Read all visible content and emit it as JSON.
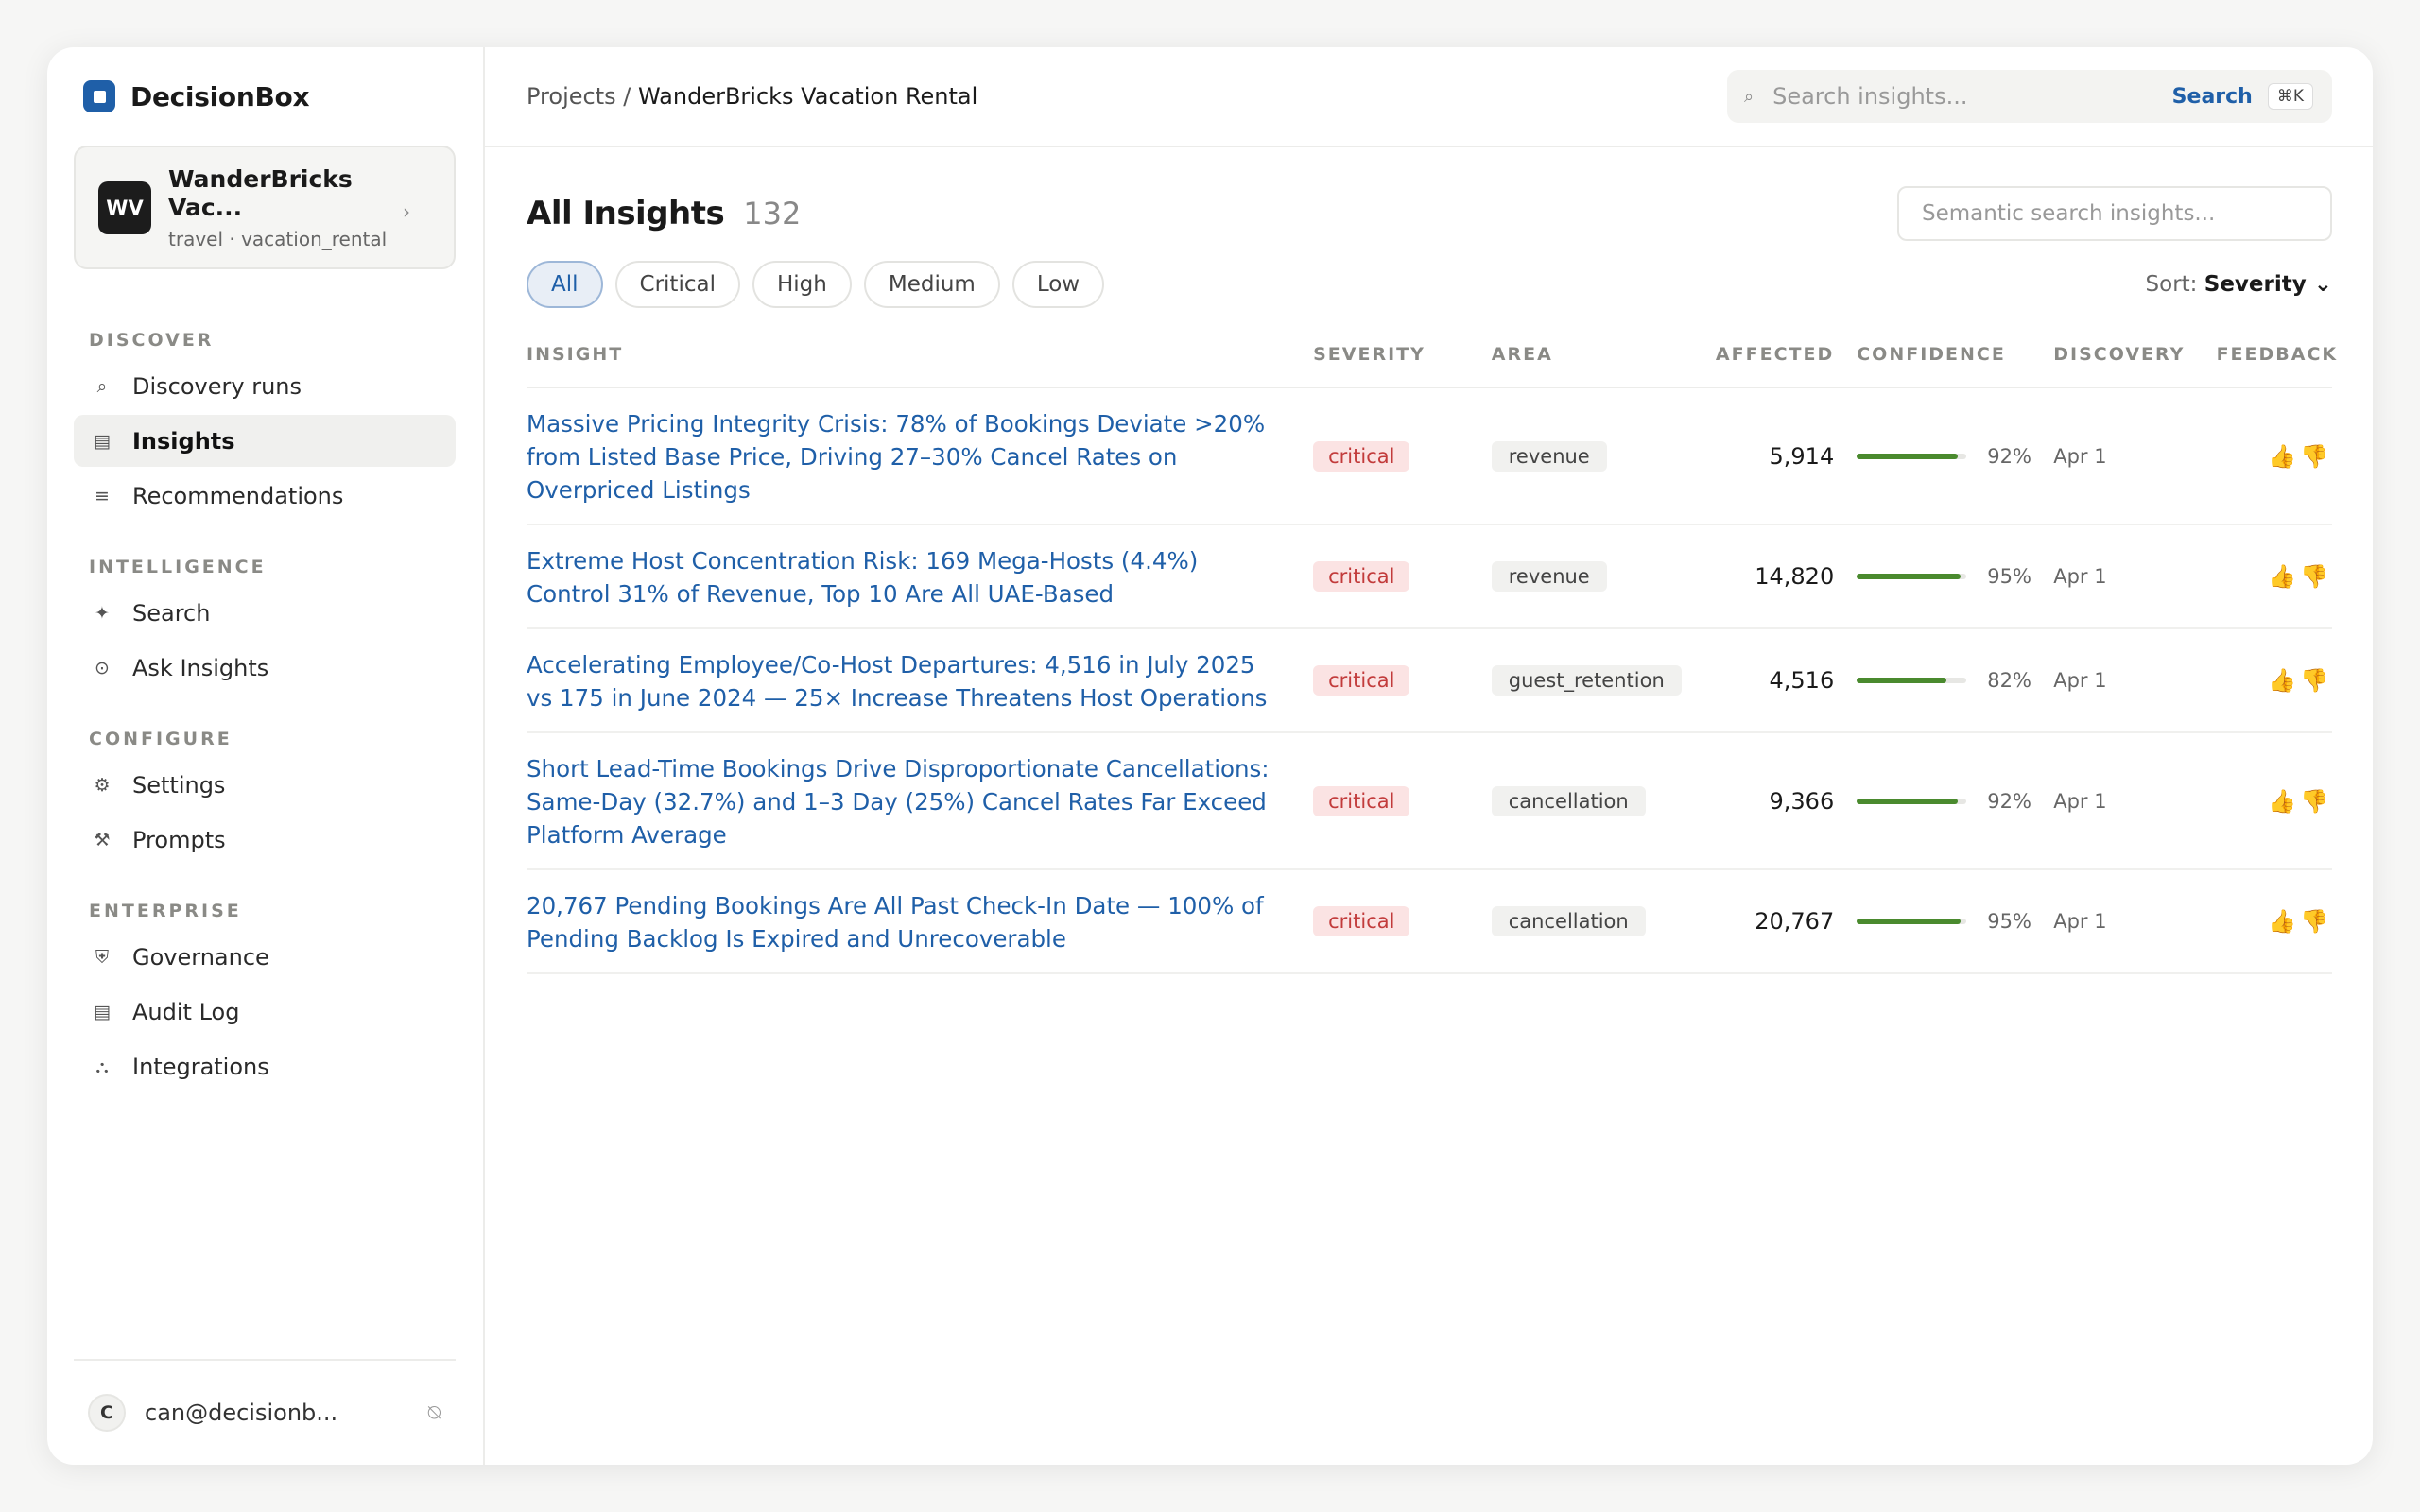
{
  "app": {
    "name": "DecisionBox"
  },
  "project": {
    "initials": "WV",
    "name": "WanderBricks Vac...",
    "meta": "travel · vacation_rental"
  },
  "sidebar": {
    "sections": [
      {
        "title": "DISCOVER",
        "items": [
          {
            "label": "Discovery runs",
            "icon": "search-icon",
            "glyph": "⌕"
          },
          {
            "label": "Insights",
            "icon": "list-icon",
            "glyph": "▤"
          },
          {
            "label": "Recommendations",
            "icon": "menu-icon",
            "glyph": "≡"
          }
        ]
      },
      {
        "title": "INTELLIGENCE",
        "items": [
          {
            "label": "Search",
            "icon": "sparkle-icon",
            "glyph": "✦"
          },
          {
            "label": "Ask Insights",
            "icon": "chat-icon",
            "glyph": "⊙"
          }
        ]
      },
      {
        "title": "CONFIGURE",
        "items": [
          {
            "label": "Settings",
            "icon": "gear-icon",
            "glyph": "⚙"
          },
          {
            "label": "Prompts",
            "icon": "tools-icon",
            "glyph": "⚒"
          }
        ]
      },
      {
        "title": "ENTERPRISE",
        "items": [
          {
            "label": "Governance",
            "icon": "shield-icon",
            "glyph": "⛨"
          },
          {
            "label": "Audit Log",
            "icon": "log-icon",
            "glyph": "▤"
          },
          {
            "label": "Integrations",
            "icon": "integrations-icon",
            "glyph": "⛬"
          }
        ]
      }
    ],
    "active": "Insights"
  },
  "user": {
    "initial": "C",
    "email": "can@decisionb..."
  },
  "topbar": {
    "breadcrumb_root": "Projects",
    "breadcrumb_sep": " / ",
    "breadcrumb_current": "WanderBricks Vacation Rental",
    "search_placeholder": "Search insights...",
    "search_button": "Search",
    "shortcut": "⌘K"
  },
  "page": {
    "title": "All Insights",
    "count": "132",
    "semantic_placeholder": "Semantic search insights...",
    "filters": [
      "All",
      "Critical",
      "High",
      "Medium",
      "Low"
    ],
    "active_filter": "All",
    "sort_label": "Sort:",
    "sort_value": "Severity ⌄"
  },
  "table": {
    "headers": [
      "INSIGHT",
      "SEVERITY",
      "AREA",
      "AFFECTED",
      "CONFIDENCE",
      "DISCOVERY",
      "FEEDBACK"
    ],
    "rows": [
      {
        "insight": "Massive Pricing Integrity Crisis: 78% of Bookings Deviate >20% from Listed Base Price, Driving 27–30% Cancel Rates on Overpriced Listings",
        "severity": "critical",
        "area": "revenue",
        "affected": "5,914",
        "confidence": 92,
        "confidence_label": "92%",
        "discovery": "Apr 1"
      },
      {
        "insight": "Extreme Host Concentration Risk: 169 Mega-Hosts (4.4%) Control 31% of Revenue, Top 10 Are All UAE-Based",
        "severity": "critical",
        "area": "revenue",
        "affected": "14,820",
        "confidence": 95,
        "confidence_label": "95%",
        "discovery": "Apr 1"
      },
      {
        "insight": "Accelerating Employee/Co-Host Departures: 4,516 in July 2025 vs 175 in June 2024 — 25× Increase Threatens Host Operations",
        "severity": "critical",
        "area": "guest_retention",
        "affected": "4,516",
        "confidence": 82,
        "confidence_label": "82%",
        "discovery": "Apr 1"
      },
      {
        "insight": "Short Lead-Time Bookings Drive Disproportionate Cancellations: Same-Day (32.7%) and 1–3 Day (25%) Cancel Rates Far Exceed Platform Average",
        "severity": "critical",
        "area": "cancellation",
        "affected": "9,366",
        "confidence": 92,
        "confidence_label": "92%",
        "discovery": "Apr 1"
      },
      {
        "insight": "20,767 Pending Bookings Are All Past Check-In Date — 100% of Pending Backlog Is Expired and Unrecoverable",
        "severity": "critical",
        "area": "cancellation",
        "affected": "20,767",
        "confidence": 95,
        "confidence_label": "95%",
        "discovery": "Apr 1"
      }
    ],
    "feedback_up": "👍",
    "feedback_down": "👎"
  },
  "colors": {
    "accent": "#1f5fa8",
    "critical_bg": "#fbe3e3",
    "critical_text": "#c23b3b",
    "confidence": "#4a8a2e"
  }
}
